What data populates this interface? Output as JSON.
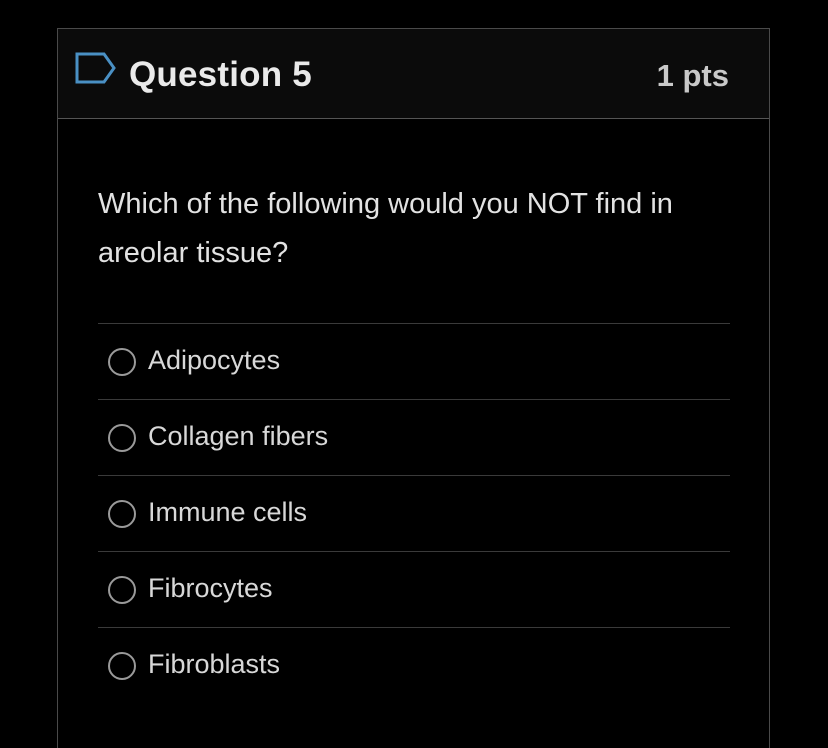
{
  "question": {
    "title": "Question 5",
    "points": "1 pts",
    "text": "Which of the following would you NOT find in areolar tissue?",
    "flag_icon": "flag-icon"
  },
  "answers": [
    {
      "label": "Adipocytes"
    },
    {
      "label": "Collagen fibers"
    },
    {
      "label": "Immune cells"
    },
    {
      "label": "Fibrocytes"
    },
    {
      "label": "Fibroblasts"
    }
  ],
  "colors": {
    "background": "#000000",
    "header_bg": "#0b0b0b",
    "flag_stroke": "#4a90c4",
    "text": "#e2e2e2",
    "radio_border": "#9a9a9a",
    "divider": "#3a3a3a"
  }
}
